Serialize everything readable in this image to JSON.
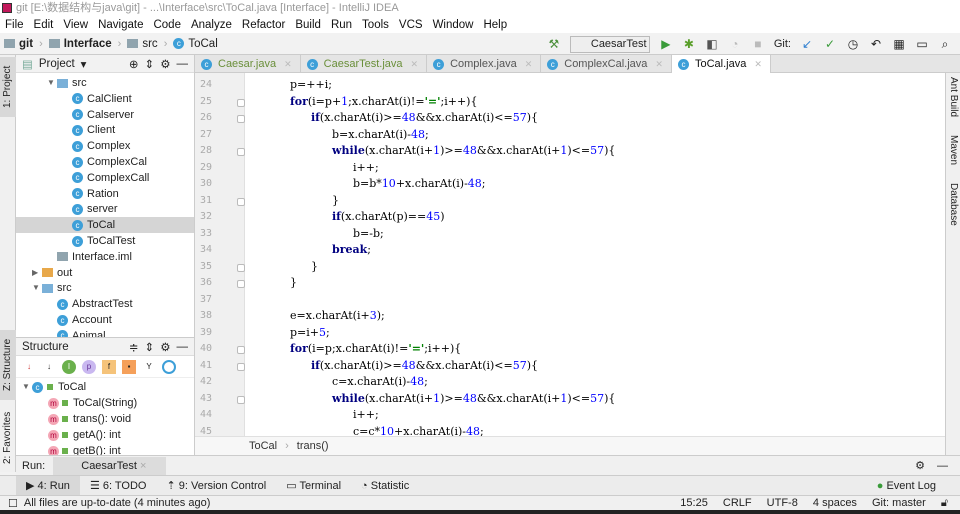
{
  "window": {
    "title": "git [E:\\数据结构与java\\git] - ...\\Interface\\src\\ToCal.java [Interface] - IntelliJ IDEA"
  },
  "menu": [
    "File",
    "Edit",
    "View",
    "Navigate",
    "Code",
    "Analyze",
    "Refactor",
    "Build",
    "Run",
    "Tools",
    "VCS",
    "Window",
    "Help"
  ],
  "breadcrumb": [
    "git",
    "Interface",
    "src",
    "ToCal"
  ],
  "toolbar": {
    "run_config": "CaesarTest",
    "git_label": "Git:",
    "icons": [
      "hammer-icon",
      "run-icon",
      "debug-icon",
      "coverage-icon",
      "profile-icon",
      "stop-icon",
      "git-update-icon",
      "git-commit-icon",
      "history-icon",
      "revert-icon",
      "project-structure-icon",
      "terminal-icon",
      "search-icon"
    ]
  },
  "left_stripe": [
    "1: Project",
    "Z: Structure",
    "2: Favorites"
  ],
  "right_stripe": [
    "Ant Build",
    "Maven",
    "Database"
  ],
  "project": {
    "title": "Project",
    "items": [
      {
        "label": "src",
        "type": "folder",
        "level": 2,
        "expanded": true
      },
      {
        "label": "CalClient",
        "type": "class",
        "level": 3
      },
      {
        "label": "Calserver",
        "type": "class",
        "level": 3
      },
      {
        "label": "Client",
        "type": "class",
        "level": 3
      },
      {
        "label": "Complex",
        "type": "class",
        "level": 3
      },
      {
        "label": "ComplexCal",
        "type": "class",
        "level": 3
      },
      {
        "label": "ComplexCall",
        "type": "class",
        "level": 3
      },
      {
        "label": "Ration",
        "type": "class",
        "level": 3
      },
      {
        "label": "server",
        "type": "class",
        "level": 3
      },
      {
        "label": "ToCal",
        "type": "class",
        "level": 3,
        "selected": true
      },
      {
        "label": "ToCalTest",
        "type": "class",
        "level": 3
      },
      {
        "label": "Interface.iml",
        "type": "file",
        "level": 2
      },
      {
        "label": "out",
        "type": "folder",
        "level": 1,
        "expanded": false
      },
      {
        "label": "src",
        "type": "folder",
        "level": 1,
        "expanded": true
      },
      {
        "label": "AbstractTest",
        "type": "class",
        "level": 2
      },
      {
        "label": "Account",
        "type": "class",
        "level": 2
      },
      {
        "label": "Animal",
        "type": "class",
        "level": 2
      }
    ]
  },
  "structure": {
    "title": "Structure",
    "root": "ToCal",
    "members": [
      "ToCal(String)",
      "trans(): void",
      "getA(): int",
      "getB(): int"
    ]
  },
  "tabs": [
    {
      "label": "Caesar.java",
      "style": "green"
    },
    {
      "label": "CaesarTest.java",
      "style": "green"
    },
    {
      "label": "Complex.java",
      "style": "normal"
    },
    {
      "label": "ComplexCal.java",
      "style": "normal"
    },
    {
      "label": "ToCal.java",
      "style": "active"
    }
  ],
  "editor": {
    "lines": [
      {
        "n": 24,
        "indent": 2,
        "tokens": [
          [
            "p=++i;",
            ""
          ]
        ]
      },
      {
        "n": 25,
        "indent": 2,
        "fold": true,
        "tokens": [
          [
            "for",
            "kw"
          ],
          [
            "(i=p+",
            ""
          ],
          [
            "1",
            "num"
          ],
          [
            ";x.charAt(i)!=",
            ""
          ],
          [
            "'='",
            "str"
          ],
          [
            ";i++){",
            ""
          ]
        ]
      },
      {
        "n": 26,
        "indent": 3,
        "fold": true,
        "tokens": [
          [
            "if",
            "kw"
          ],
          [
            "(x.charAt(i)>=",
            ""
          ],
          [
            "48",
            "num"
          ],
          [
            "&&x.charAt(i)<=",
            ""
          ],
          [
            "57",
            "num"
          ],
          [
            "){",
            ""
          ]
        ]
      },
      {
        "n": 27,
        "indent": 4,
        "tokens": [
          [
            "b=x.charAt(i)-",
            ""
          ],
          [
            "48",
            "num"
          ],
          [
            ";",
            ""
          ]
        ]
      },
      {
        "n": 28,
        "indent": 4,
        "fold": true,
        "tokens": [
          [
            "while",
            "kw"
          ],
          [
            "(x.charAt(i+",
            ""
          ],
          [
            "1",
            "num"
          ],
          [
            ")>=",
            ""
          ],
          [
            "48",
            "num"
          ],
          [
            "&&x.charAt(i+",
            ""
          ],
          [
            "1",
            "num"
          ],
          [
            ")<=",
            ""
          ],
          [
            "57",
            "num"
          ],
          [
            "){",
            ""
          ]
        ]
      },
      {
        "n": 29,
        "indent": 5,
        "tokens": [
          [
            "i++;",
            ""
          ]
        ]
      },
      {
        "n": 30,
        "indent": 5,
        "tokens": [
          [
            "b=b*",
            ""
          ],
          [
            "10",
            "num"
          ],
          [
            "+x.charAt(i)-",
            ""
          ],
          [
            "48",
            "num"
          ],
          [
            ";",
            ""
          ]
        ]
      },
      {
        "n": 31,
        "indent": 4,
        "fold": true,
        "tokens": [
          [
            "}",
            ""
          ]
        ]
      },
      {
        "n": 32,
        "indent": 4,
        "tokens": [
          [
            "if",
            "kw"
          ],
          [
            "(x.charAt(p)==",
            ""
          ],
          [
            "45",
            "num"
          ],
          [
            ")",
            ""
          ]
        ]
      },
      {
        "n": 33,
        "indent": 5,
        "tokens": [
          [
            "b=-b;",
            ""
          ]
        ]
      },
      {
        "n": 34,
        "indent": 4,
        "tokens": [
          [
            "break",
            "kw"
          ],
          [
            ";",
            ""
          ]
        ]
      },
      {
        "n": 35,
        "indent": 3,
        "fold": true,
        "tokens": [
          [
            "}",
            ""
          ]
        ]
      },
      {
        "n": 36,
        "indent": 2,
        "fold": true,
        "tokens": [
          [
            "}",
            ""
          ]
        ]
      },
      {
        "n": 37,
        "indent": 2,
        "tokens": []
      },
      {
        "n": 38,
        "indent": 2,
        "tokens": [
          [
            "e=x.charAt(i+",
            ""
          ],
          [
            "3",
            "num"
          ],
          [
            ");",
            ""
          ]
        ]
      },
      {
        "n": 39,
        "indent": 2,
        "tokens": [
          [
            "p=i+",
            ""
          ],
          [
            "5",
            "num"
          ],
          [
            ";",
            ""
          ]
        ]
      },
      {
        "n": 40,
        "indent": 2,
        "fold": true,
        "tokens": [
          [
            "for",
            "kw"
          ],
          [
            "(i=p;x.charAt(i)!=",
            ""
          ],
          [
            "'='",
            "str"
          ],
          [
            ";i++){",
            ""
          ]
        ]
      },
      {
        "n": 41,
        "indent": 3,
        "fold": true,
        "tokens": [
          [
            "if",
            "kw"
          ],
          [
            "(x.charAt(i)>=",
            ""
          ],
          [
            "48",
            "num"
          ],
          [
            "&&x.charAt(i)<=",
            ""
          ],
          [
            "57",
            "num"
          ],
          [
            "){",
            ""
          ]
        ]
      },
      {
        "n": 42,
        "indent": 4,
        "tokens": [
          [
            "c=x.charAt(i)-",
            ""
          ],
          [
            "48",
            "num"
          ],
          [
            ";",
            ""
          ]
        ]
      },
      {
        "n": 43,
        "indent": 4,
        "fold": true,
        "tokens": [
          [
            "while",
            "kw"
          ],
          [
            "(x.charAt(i+",
            ""
          ],
          [
            "1",
            "num"
          ],
          [
            ")>=",
            ""
          ],
          [
            "48",
            "num"
          ],
          [
            "&&x.charAt(i+",
            ""
          ],
          [
            "1",
            "num"
          ],
          [
            ")<=",
            ""
          ],
          [
            "57",
            "num"
          ],
          [
            "){",
            ""
          ]
        ]
      },
      {
        "n": 44,
        "indent": 5,
        "tokens": [
          [
            "i++;",
            ""
          ]
        ]
      },
      {
        "n": 45,
        "indent": 5,
        "tokens": [
          [
            "c=c*",
            ""
          ],
          [
            "10",
            "num"
          ],
          [
            "+x.charAt(i)-",
            ""
          ],
          [
            "48",
            "num"
          ],
          [
            ";",
            ""
          ]
        ]
      }
    ]
  },
  "editor_breadcrumb": [
    "ToCal",
    "trans()"
  ],
  "run": {
    "label": "Run:",
    "tab": "CaesarTest"
  },
  "bottom_tabs": [
    "4: Run",
    "6: TODO",
    "9: Version Control",
    "Terminal",
    "Statistic"
  ],
  "event_log": "Event Log",
  "status": {
    "message": "All files are up-to-date (4 minutes ago)",
    "position": "15:25",
    "line_sep": "CRLF",
    "encoding": "UTF-8",
    "indent": "4 spaces",
    "branch": "Git: master"
  }
}
